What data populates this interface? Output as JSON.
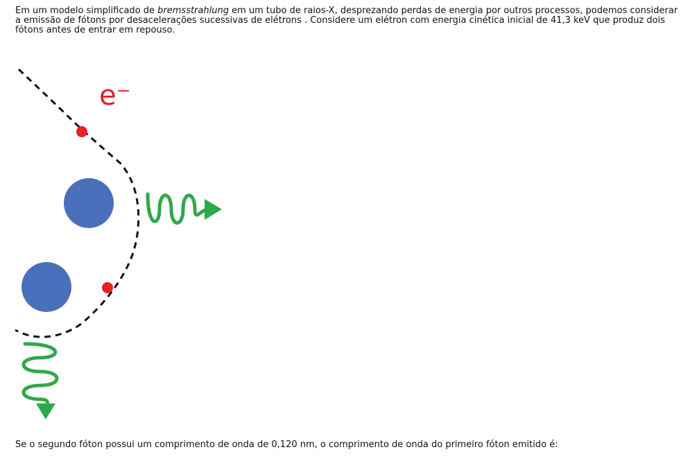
{
  "intro": {
    "part1": "Em um modelo simplificado de ",
    "italic_term": "bremsstrahlung",
    "part2": " em um tubo de raios-X, desprezando perdas de energia por outros processos, podemos considerar a emissão de fótons por desacelerações sucessivas de elétrons . Considere um elétron com energia cinética inicial de 41,3 keV que produz dois fótons antes de entrar em repouso."
  },
  "figure": {
    "electron_label": "e⁻",
    "colors": {
      "electron": "#e8201f",
      "nucleus": "#4a6fbb",
      "photon": "#2fa84a",
      "path": "#111111"
    }
  },
  "question": "Se o segundo fóton possui um comprimento de onda de 0,120 nm, o comprimento de onda do primeiro fóton emitido é:"
}
